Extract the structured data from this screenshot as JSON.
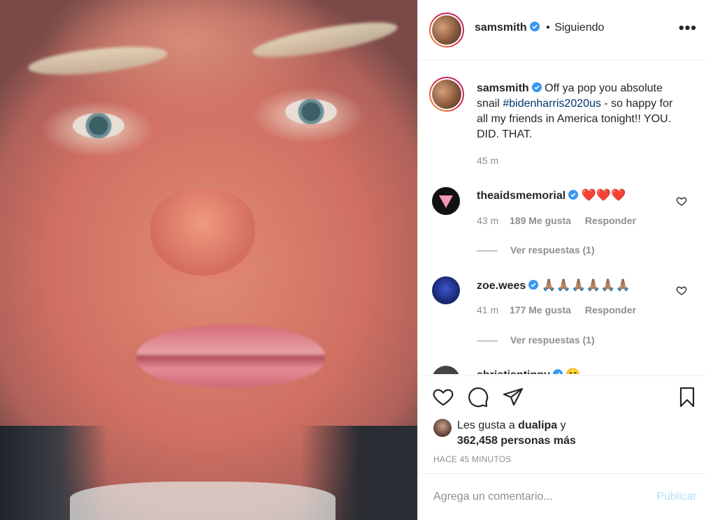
{
  "colors": {
    "accent": "#0095f6",
    "verified": "#3897f0",
    "text": "#262626",
    "muted": "#8e8e8e",
    "publish_disabled": "#b2dffc",
    "heart_red": "#ed4956"
  },
  "header": {
    "username": "samsmith",
    "separator": "•",
    "follow_status": "Siguiendo",
    "more_icon": "more-horizontal-icon"
  },
  "caption": {
    "username": "samsmith",
    "text_before": " Off ya pop you absolute snail ",
    "hashtag": "#bidenharris2020us",
    "text_after": " - so happy for all my friends in America tonight!! YOU. DID. THAT.",
    "time": "45 m"
  },
  "comments": [
    {
      "username": "theaidsmemorial",
      "emoji": "❤️❤️❤️",
      "time": "43 m",
      "likes": "189 Me gusta",
      "reply": "Responder",
      "view_replies": "Ver respuestas (1)"
    },
    {
      "username": "zoe.wees",
      "emoji": "🙏🏽🙏🏽🙏🏽🙏🏽🙏🏽🙏🏽",
      "time": "41 m",
      "likes": "177 Me gusta",
      "reply": "Responder",
      "view_replies": "Ver respuestas (1)"
    },
    {
      "username": "christiantinny",
      "emoji": "😊"
    }
  ],
  "actions": {
    "like_icon": "heart-icon",
    "comment_icon": "comment-icon",
    "share_icon": "paper-plane-icon",
    "save_icon": "bookmark-icon",
    "likes_prefix": "Les gusta a ",
    "likes_user": "dualipa",
    "likes_and": " y",
    "likes_count": "362,458 personas más",
    "posted_ago": "HACE 45 MINUTOS"
  },
  "add_comment": {
    "placeholder": "Agrega un comentario...",
    "publish_label": "Publicar"
  }
}
